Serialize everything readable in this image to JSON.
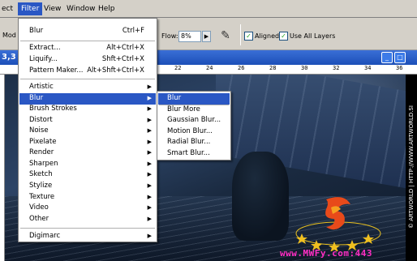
{
  "menubar": {
    "items": [
      "ect",
      "Filter",
      "View",
      "Window",
      "Help"
    ]
  },
  "options": {
    "mode_label": "Mod",
    "flow_label": "Flow:",
    "flow_value": "8%",
    "aligned_label": "Aligned",
    "use_all_layers_label": "Use All Layers",
    "aligned_checked": true,
    "use_all_layers_checked": true
  },
  "document": {
    "zoom": "3,3",
    "ruler_ticks": [
      "22",
      "24",
      "26",
      "28",
      "30",
      "32",
      "34",
      "36"
    ]
  },
  "filter_menu": {
    "last_filter": {
      "label": "Blur",
      "shortcut": "Ctrl+F"
    },
    "group1": [
      {
        "label": "Extract...",
        "shortcut": "Alt+Ctrl+X"
      },
      {
        "label": "Liquify...",
        "shortcut": "Shft+Ctrl+X"
      },
      {
        "label": "Pattern Maker...",
        "shortcut": "Alt+Shft+Ctrl+X"
      }
    ],
    "submenus": [
      "Artistic",
      "Blur",
      "Brush Strokes",
      "Distort",
      "Noise",
      "Pixelate",
      "Render",
      "Sharpen",
      "Sketch",
      "Stylize",
      "Texture",
      "Video",
      "Other"
    ],
    "selected_submenu": "Blur",
    "last_group": [
      "Digimarc"
    ]
  },
  "blur_submenu": {
    "items": [
      "Blur",
      "Blur More",
      "Gaussian Blur...",
      "Motion Blur...",
      "Radial Blur...",
      "Smart Blur..."
    ],
    "selected": "Blur"
  },
  "watermark": {
    "side_text": "© ARTWORLD | HTTP://WWW.ARTWORLD.SI",
    "bottom_text": "www.MWFy.com:443"
  },
  "colors": {
    "accent": "#2a57c4",
    "watermark_pink": "#ff2ec4"
  }
}
